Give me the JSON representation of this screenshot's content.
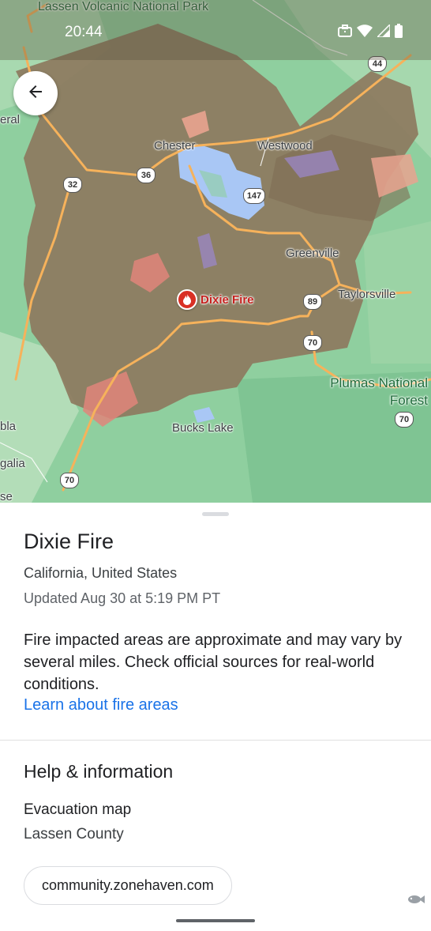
{
  "status_bar": {
    "time": "20:44",
    "icons": [
      "briefcase-icon",
      "wifi-icon",
      "signal-icon",
      "battery-icon"
    ]
  },
  "map": {
    "labels": {
      "lassen": "Lassen Volcanic National Park",
      "eral": "eral",
      "chester": "Chester",
      "westwood": "Westwood",
      "greenville": "Greenville",
      "taylorsville": "Taylorsville",
      "plumas": "Plumas National Forest",
      "bucks_lake": "Bucks Lake",
      "bla": "bla",
      "galia": "galia",
      "se": "se"
    },
    "highways": {
      "h44": "44",
      "h36": "36",
      "h32": "32",
      "h147": "147",
      "h89": "89",
      "h70a": "70",
      "h70b": "70",
      "h70c": "70"
    },
    "fire_marker_label": "Dixie Fire"
  },
  "sheet": {
    "title": "Dixie Fire",
    "location": "California, United States",
    "updated": "Updated Aug 30 at 5:19 PM PT",
    "description": "Fire impacted areas are approximate and may vary by several miles. Check official sources for real-world conditions.",
    "learn_link": "Learn about fire areas",
    "help_title": "Help & information",
    "evac_title": "Evacuation map",
    "evac_county": "Lassen County",
    "chip_label": "community.zonehaven.com"
  },
  "colors": {
    "fire_red": "#d93025",
    "link_blue": "#1a73e8",
    "burn_area": "#8d7a5e",
    "forest_green": "#8fcf9f"
  }
}
